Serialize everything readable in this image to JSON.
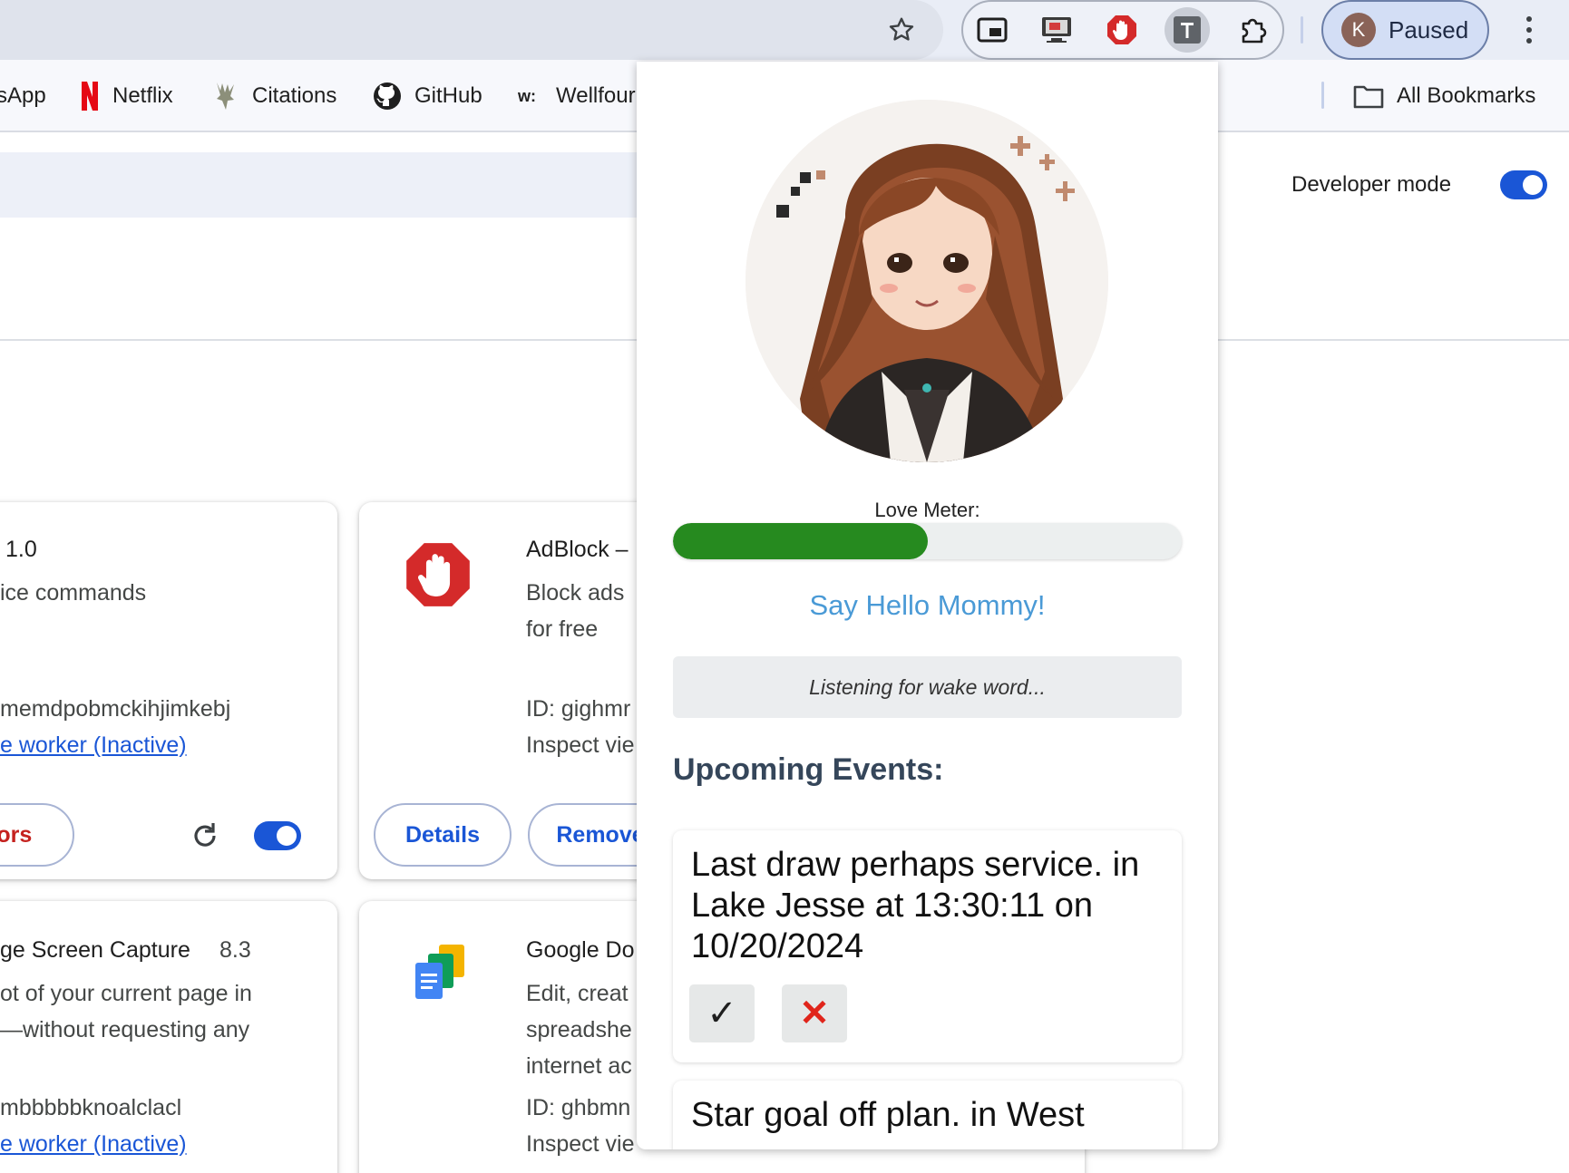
{
  "browser": {
    "profile": {
      "initial": "K",
      "label": "Paused"
    },
    "extensions_toolbar": [
      "picture-in-picture",
      "screen-capture",
      "adblock",
      "text-extension",
      "extensions-puzzle"
    ]
  },
  "bookmarks": {
    "items": [
      "sApp",
      "Netflix",
      "Citations",
      "GitHub",
      "Wellfour"
    ],
    "all_bookmarks": "All Bookmarks"
  },
  "extensions_page": {
    "developer_mode_label": "Developer mode",
    "developer_mode_on": true,
    "cards": {
      "card1": {
        "version": "1.0",
        "description": "ice commands",
        "id_tail": "memdpobmckihjimkebj",
        "inspect_link": "e worker (Inactive)",
        "errors_button": "rors",
        "enabled": true
      },
      "card2": {
        "name": "AdBlock –",
        "description_1": "Block ads",
        "description_2": "for free",
        "id": "ID: gighmr",
        "inspect": "Inspect vie",
        "details_button": "Details",
        "remove_button": "Remove"
      },
      "card3": {
        "name": "ge Screen Capture",
        "version": "8.3",
        "description_1": "ot of your current page in",
        "description_2": "—without requesting any",
        "id_tail": "mbbbbbknoalclacl",
        "inspect_link": "e worker (Inactive)"
      },
      "card4": {
        "name": "Google Do",
        "description_1": "Edit, creat",
        "description_2": "spreadshe",
        "description_3": "internet ac",
        "id": "ID: ghbmn",
        "inspect": "Inspect vie"
      }
    }
  },
  "popup": {
    "meter_label": "Love Meter:",
    "meter_value": 0.5,
    "hello_button": "Say Hello Mommy!",
    "status": "Listening for wake word...",
    "events_title": "Upcoming Events:",
    "events": [
      {
        "text": "Last draw perhaps service. in Lake Jesse at 13:30:11 on 10/20/2024",
        "accept": "✓",
        "reject": "✕"
      },
      {
        "text": "Star goal off plan. in West"
      }
    ]
  },
  "colors": {
    "meter_fill": "#268a1f",
    "hello_text": "#4a9ad6",
    "link_blue": "#1a56d6",
    "adblock_red": "#d42a2a",
    "netflix_red": "#e50914",
    "reject_red": "#e0251b"
  }
}
